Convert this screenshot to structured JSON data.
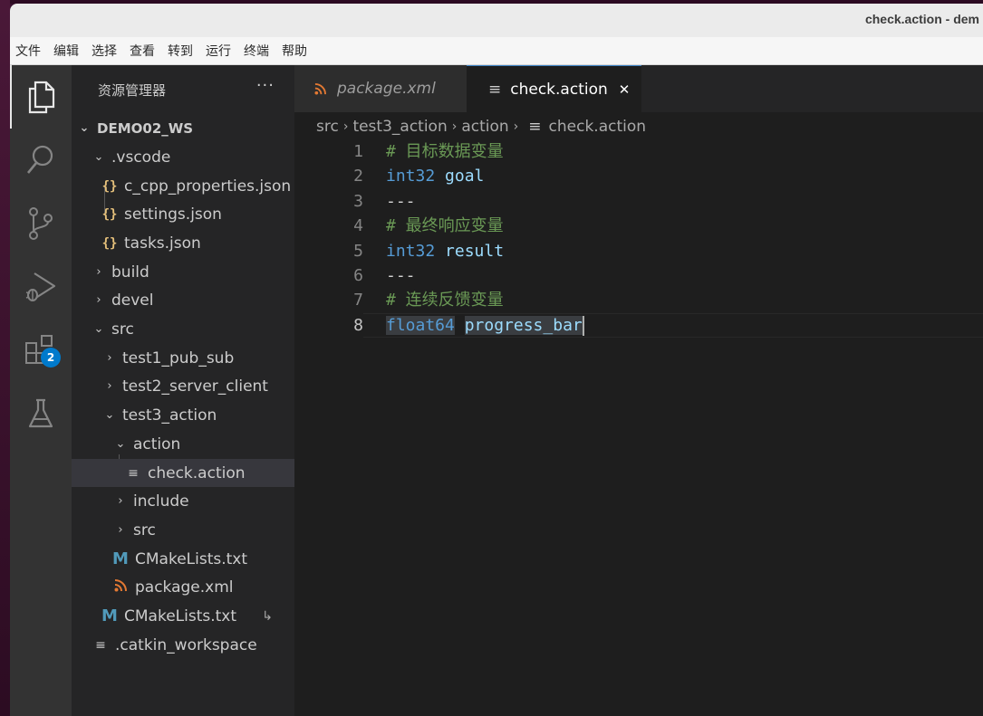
{
  "window": {
    "title": "check.action - dem"
  },
  "menu": [
    "文件",
    "编辑",
    "选择",
    "查看",
    "转到",
    "运行",
    "终端",
    "帮助"
  ],
  "activity_bar": {
    "items": [
      "explorer-icon",
      "search-icon",
      "source-control-icon",
      "run-debug-icon",
      "extensions-icon",
      "testing-icon"
    ],
    "extensions_badge": "2"
  },
  "sidebar": {
    "title": "资源管理器",
    "more": "···",
    "tree": [
      {
        "label": "DEMO02_WS",
        "type": "folder",
        "expanded": true
      },
      {
        "label": ".vscode",
        "type": "folder",
        "expanded": true
      },
      {
        "label": "c_cpp_properties.json",
        "type": "json"
      },
      {
        "label": "settings.json",
        "type": "json"
      },
      {
        "label": "tasks.json",
        "type": "json"
      },
      {
        "label": "build",
        "type": "folder",
        "expanded": false
      },
      {
        "label": "devel",
        "type": "folder",
        "expanded": false
      },
      {
        "label": "src",
        "type": "folder",
        "expanded": true
      },
      {
        "label": "test1_pub_sub",
        "type": "folder",
        "expanded": false
      },
      {
        "label": "test2_server_client",
        "type": "folder",
        "expanded": false
      },
      {
        "label": "test3_action",
        "type": "folder",
        "expanded": true
      },
      {
        "label": "action",
        "type": "folder",
        "expanded": true
      },
      {
        "label": "check.action",
        "type": "text",
        "selected": true
      },
      {
        "label": "include",
        "type": "folder",
        "expanded": false
      },
      {
        "label": "src",
        "type": "folder",
        "expanded": false
      },
      {
        "label": "CMakeLists.txt",
        "type": "cmake"
      },
      {
        "label": "package.xml",
        "type": "xml"
      },
      {
        "label": "CMakeLists.txt",
        "type": "cmake",
        "git_mark": "↳"
      },
      {
        "label": ".catkin_workspace",
        "type": "text"
      }
    ]
  },
  "tabs": [
    {
      "label": "package.xml",
      "active": false
    },
    {
      "label": "check.action",
      "active": true,
      "close": "✕"
    }
  ],
  "breadcrumb": [
    "src",
    "test3_action",
    "action",
    "check.action"
  ],
  "code": {
    "current_line": 8,
    "lines": [
      {
        "n": "1",
        "tokens": [
          {
            "t": "# 目标数据变量",
            "c": "comment"
          }
        ]
      },
      {
        "n": "2",
        "tokens": [
          {
            "t": "int32",
            "c": "type"
          },
          {
            "t": " ",
            "c": "sep"
          },
          {
            "t": "goal",
            "c": "name"
          }
        ]
      },
      {
        "n": "3",
        "tokens": [
          {
            "t": "---",
            "c": "sep"
          }
        ]
      },
      {
        "n": "4",
        "tokens": [
          {
            "t": "# 最终响应变量",
            "c": "comment"
          }
        ]
      },
      {
        "n": "5",
        "tokens": [
          {
            "t": "int32",
            "c": "type"
          },
          {
            "t": " ",
            "c": "sep"
          },
          {
            "t": "result",
            "c": "name"
          }
        ]
      },
      {
        "n": "6",
        "tokens": [
          {
            "t": "---",
            "c": "sep"
          }
        ]
      },
      {
        "n": "7",
        "tokens": [
          {
            "t": "# 连续反馈变量",
            "c": "comment"
          }
        ]
      },
      {
        "n": "8",
        "tokens": [
          {
            "t": "float64",
            "c": "type"
          },
          {
            "t": " ",
            "c": "sep"
          },
          {
            "t": "progress_bar",
            "c": "name"
          }
        ]
      }
    ]
  },
  "colors": {
    "accent": "#007acc",
    "comment": "#6a9955",
    "type": "#569cd6",
    "name": "#9cdcfe"
  }
}
